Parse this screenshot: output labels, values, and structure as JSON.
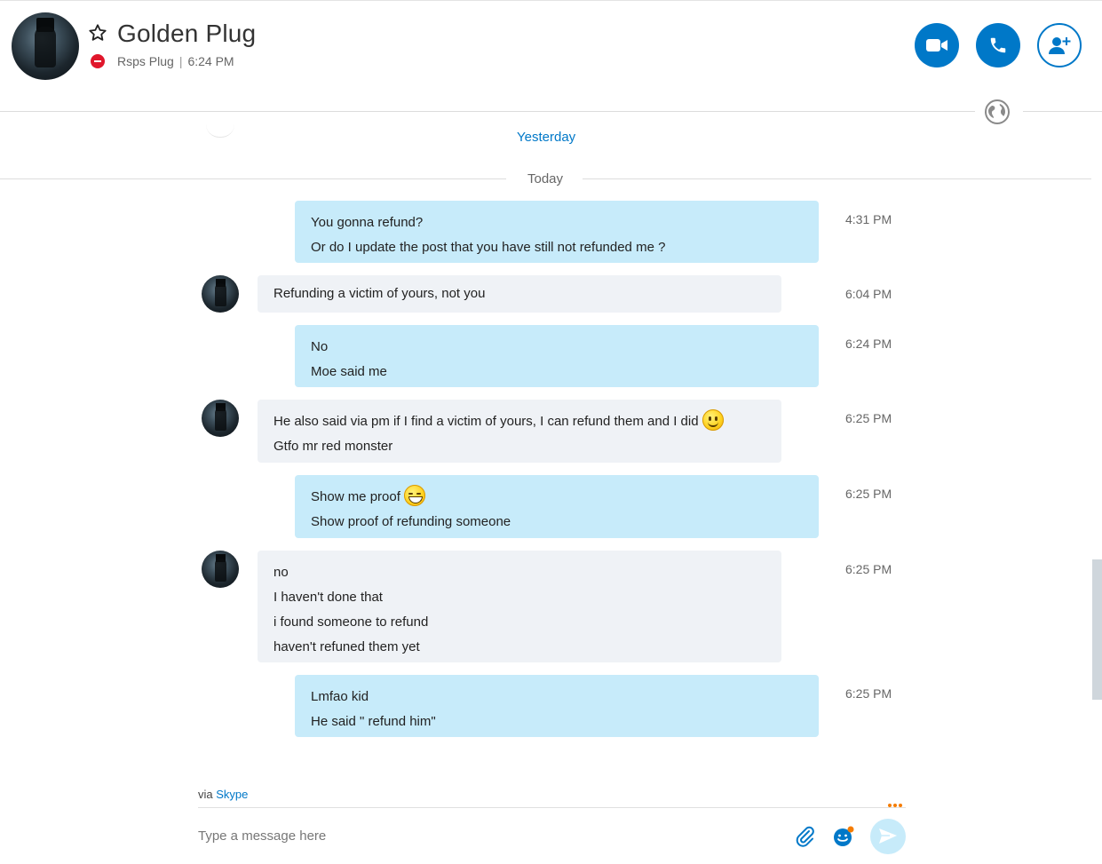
{
  "header": {
    "title": "Golden Plug",
    "status_text": "Rsps Plug",
    "separator": "|",
    "time": "6:24 PM"
  },
  "dividers": {
    "yesterday": "Yesterday",
    "today": "Today"
  },
  "messages": [
    {
      "direction": "out",
      "lines": [
        "You gonna refund?",
        "Or do I update the post that you have still not refunded me ?"
      ],
      "time": "4:31 PM"
    },
    {
      "direction": "in",
      "lines": [
        "Refunding a victim of yours, not you"
      ],
      "time": "6:04 PM"
    },
    {
      "direction": "out",
      "lines": [
        "No",
        "Moe said me"
      ],
      "time": "6:24 PM"
    },
    {
      "direction": "in",
      "lines": [
        "He also said via pm if I find a victim of yours, I can refund them and I did",
        "Gtfo mr red monster"
      ],
      "time": "6:25 PM",
      "emoji": "smile-emoji"
    },
    {
      "direction": "out",
      "lines": [
        "Show me proof",
        "Show proof of refunding someone"
      ],
      "time": "6:25 PM",
      "emoji": "grin-emoji"
    },
    {
      "direction": "in",
      "lines": [
        "no",
        "I haven't done that",
        "i found someone to refund",
        "haven't refuned them yet"
      ],
      "time": "6:25 PM"
    },
    {
      "direction": "out",
      "lines": [
        "Lmfao kid",
        "He said \" refund him\""
      ],
      "time": "6:25 PM"
    }
  ],
  "composer": {
    "via_prefix": "via",
    "via_link": "Skype",
    "placeholder": "Type a message here"
  },
  "colors": {
    "accent": "#0078c8",
    "outgoing_bubble": "#c7ebfa",
    "incoming_bubble": "#eff2f6",
    "status_busy": "#e0162b"
  }
}
